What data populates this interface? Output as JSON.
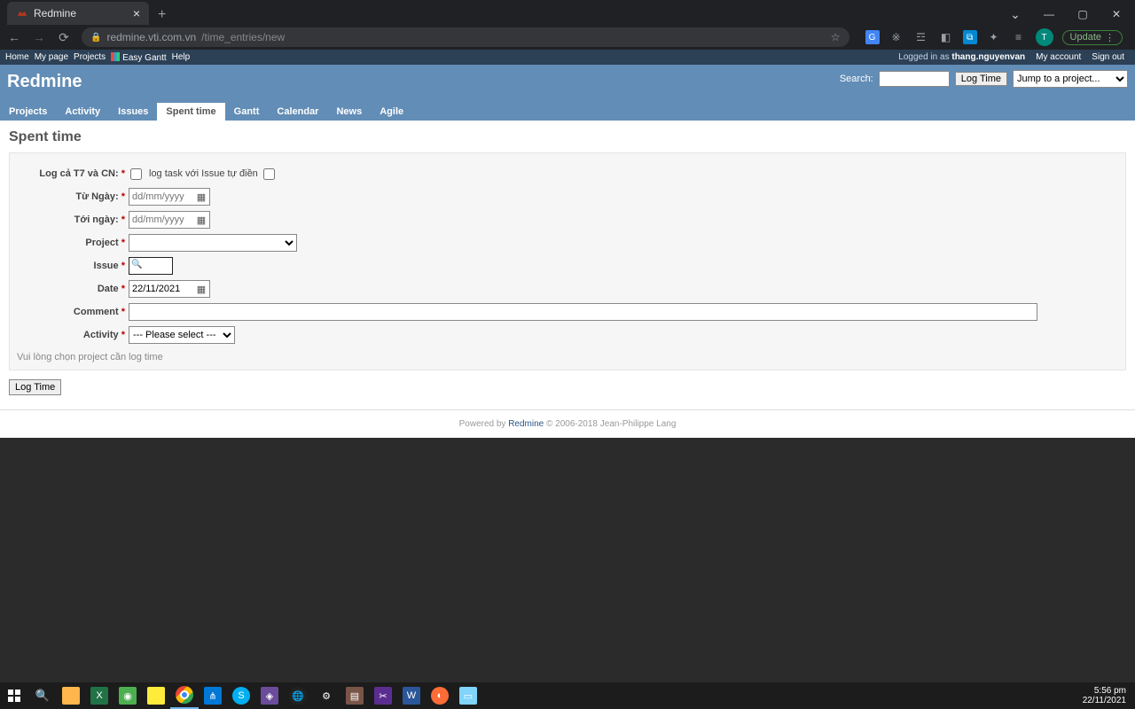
{
  "browser": {
    "tab_title": "Redmine",
    "url_host": "redmine.vti.com.vn",
    "url_path": "/time_entries/new",
    "update_label": "Update",
    "avatar_letter": "T"
  },
  "top_menu": {
    "left": [
      "Home",
      "My page",
      "Projects",
      "Easy Gantt",
      "Help"
    ],
    "logged_in_prefix": "Logged in as ",
    "username": "thang.nguyenvan",
    "right": [
      "My account",
      "Sign out"
    ]
  },
  "header": {
    "title": "Redmine",
    "search_label": "Search:",
    "log_time_btn": "Log Time",
    "jump_placeholder": "Jump to a project..."
  },
  "main_menu": [
    "Projects",
    "Activity",
    "Issues",
    "Spent time",
    "Gantt",
    "Calendar",
    "News",
    "Agile"
  ],
  "main_menu_selected": "Spent time",
  "page": {
    "heading": "Spent time",
    "labels": {
      "log_weekend": "Log cả T7 và CN:",
      "log_task_auto": "log task với Issue tự điền",
      "from_date": "Từ Ngày:",
      "to_date": "Tới ngày:",
      "project": "Project",
      "issue": "Issue",
      "date": "Date",
      "comment": "Comment",
      "activity": "Activity"
    },
    "placeholders": {
      "date": "dd/mm/yyyy"
    },
    "values": {
      "date": "22/11/2021",
      "activity_default": "--- Please select ---"
    },
    "hint": "Vui lòng chọn project cần log time",
    "submit": "Log Time"
  },
  "footer": {
    "powered_by": "Powered by ",
    "link": "Redmine",
    "copyright": " © 2006-2018 Jean-Philippe Lang"
  },
  "taskbar": {
    "time": "5:56 pm",
    "date": "22/11/2021"
  }
}
